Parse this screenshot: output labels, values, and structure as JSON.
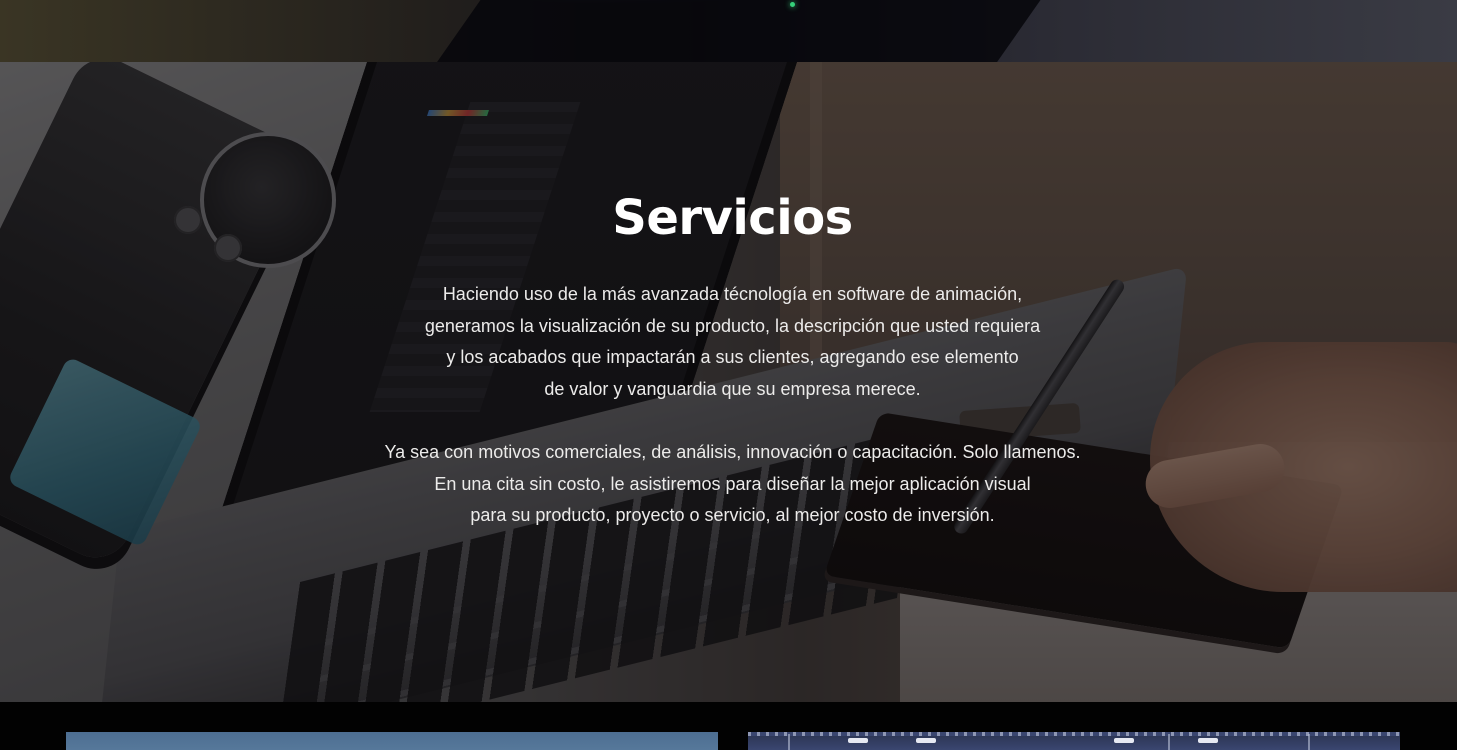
{
  "services": {
    "title": "Servicios",
    "paragraph1": [
      "Haciendo uso de la más avanzada técnología en software de animación,",
      "generamos la visualización de su producto, la descripción que usted requiera",
      "y los acabados que impactarán a sus clientes, agregando ese elemento",
      "de valor y vanguardia que su empresa merece."
    ],
    "paragraph2": [
      "Ya sea con motivos comerciales, de análisis, innovación o capacitación. Solo llamenos.",
      "En una cita sin costo, le asistiremos para diseñar la mejor aplicación visual",
      "para su producto, proyecto o servicio, al mejor costo de inversión."
    ]
  },
  "colors": {
    "title": "#ffffff",
    "text": "#ecebea",
    "overlay": "rgba(10, 8, 10, 0.48)",
    "bottom_background": "#020202"
  },
  "images": {
    "hero_background": "laptop-tablet-pen-photo",
    "top_strip": "previous-section-photo",
    "bottom_left_card": "project-card-image",
    "bottom_right_card": "project-card-image"
  }
}
